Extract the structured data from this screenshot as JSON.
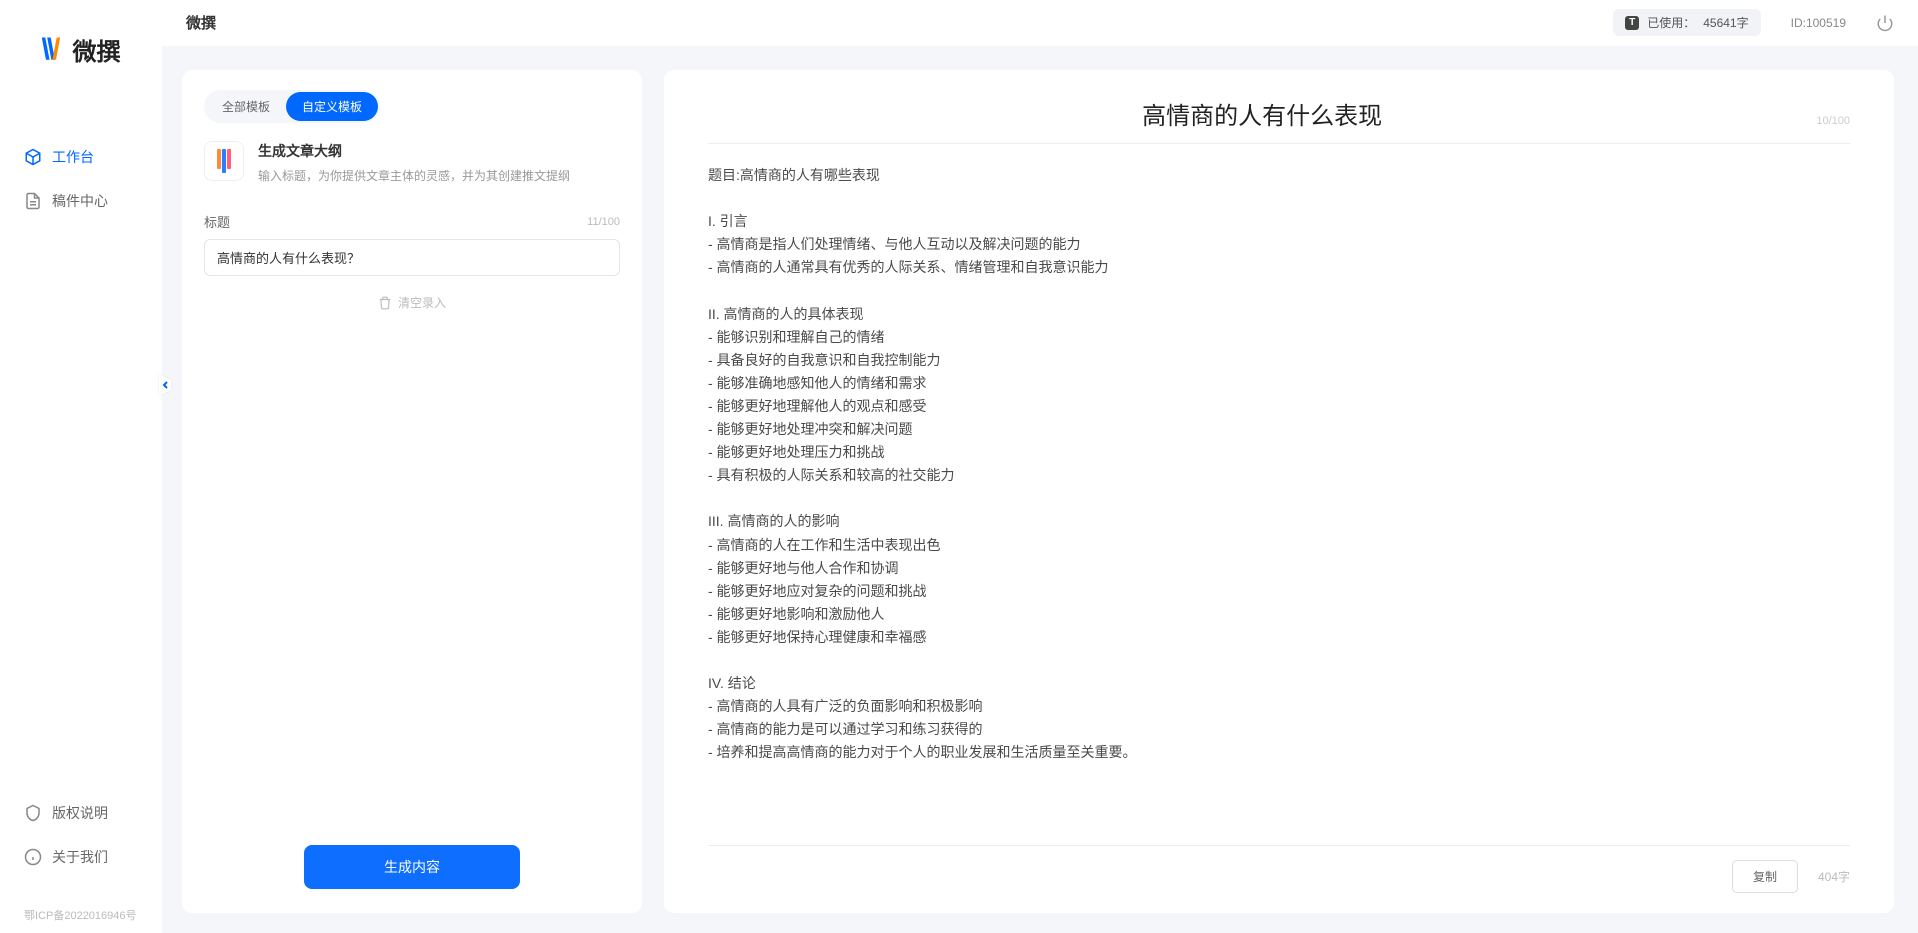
{
  "brand": "微撰",
  "topbar": {
    "title": "微撰",
    "usage_label": "已使用：",
    "usage_value": "45641字",
    "id_label": "ID:100519"
  },
  "sidebar": {
    "nav": [
      {
        "key": "workspace",
        "label": "工作台",
        "active": true
      },
      {
        "key": "drafts",
        "label": "稿件中心",
        "active": false
      }
    ],
    "bottom": [
      {
        "key": "copyright",
        "label": "版权说明"
      },
      {
        "key": "about",
        "label": "关于我们"
      }
    ],
    "icp": "鄂ICP备2022016946号"
  },
  "left": {
    "tabs": [
      {
        "key": "all",
        "label": "全部模板",
        "active": false
      },
      {
        "key": "custom",
        "label": "自定义模板",
        "active": true
      }
    ],
    "template": {
      "title": "生成文章大纲",
      "desc": "输入标题，为你提供文章主体的灵感，并为其创建推文提纲"
    },
    "field_label": "标题",
    "field_count": "11/100",
    "input_value": "高情商的人有什么表现？",
    "clear_label": "清空录入",
    "generate_label": "生成内容"
  },
  "right": {
    "title": "高情商的人有什么表现",
    "title_count": "10/100",
    "body": "题目:高情商的人有哪些表现\n\nI. 引言\n- 高情商是指人们处理情绪、与他人互动以及解决问题的能力\n- 高情商的人通常具有优秀的人际关系、情绪管理和自我意识能力\n\nII. 高情商的人的具体表现\n- 能够识别和理解自己的情绪\n- 具备良好的自我意识和自我控制能力\n- 能够准确地感知他人的情绪和需求\n- 能够更好地理解他人的观点和感受\n- 能够更好地处理冲突和解决问题\n- 能够更好地处理压力和挑战\n- 具有积极的人际关系和较高的社交能力\n\nIII. 高情商的人的影响\n- 高情商的人在工作和生活中表现出色\n- 能够更好地与他人合作和协调\n- 能够更好地应对复杂的问题和挑战\n- 能够更好地影响和激励他人\n- 能够更好地保持心理健康和幸福感\n\nIV. 结论\n- 高情商的人具有广泛的负面影响和积极影响\n- 高情商的能力是可以通过学习和练习获得的\n- 培养和提高高情商的能力对于个人的职业发展和生活质量至关重要。",
    "copy_label": "复制",
    "word_count": "404字"
  }
}
